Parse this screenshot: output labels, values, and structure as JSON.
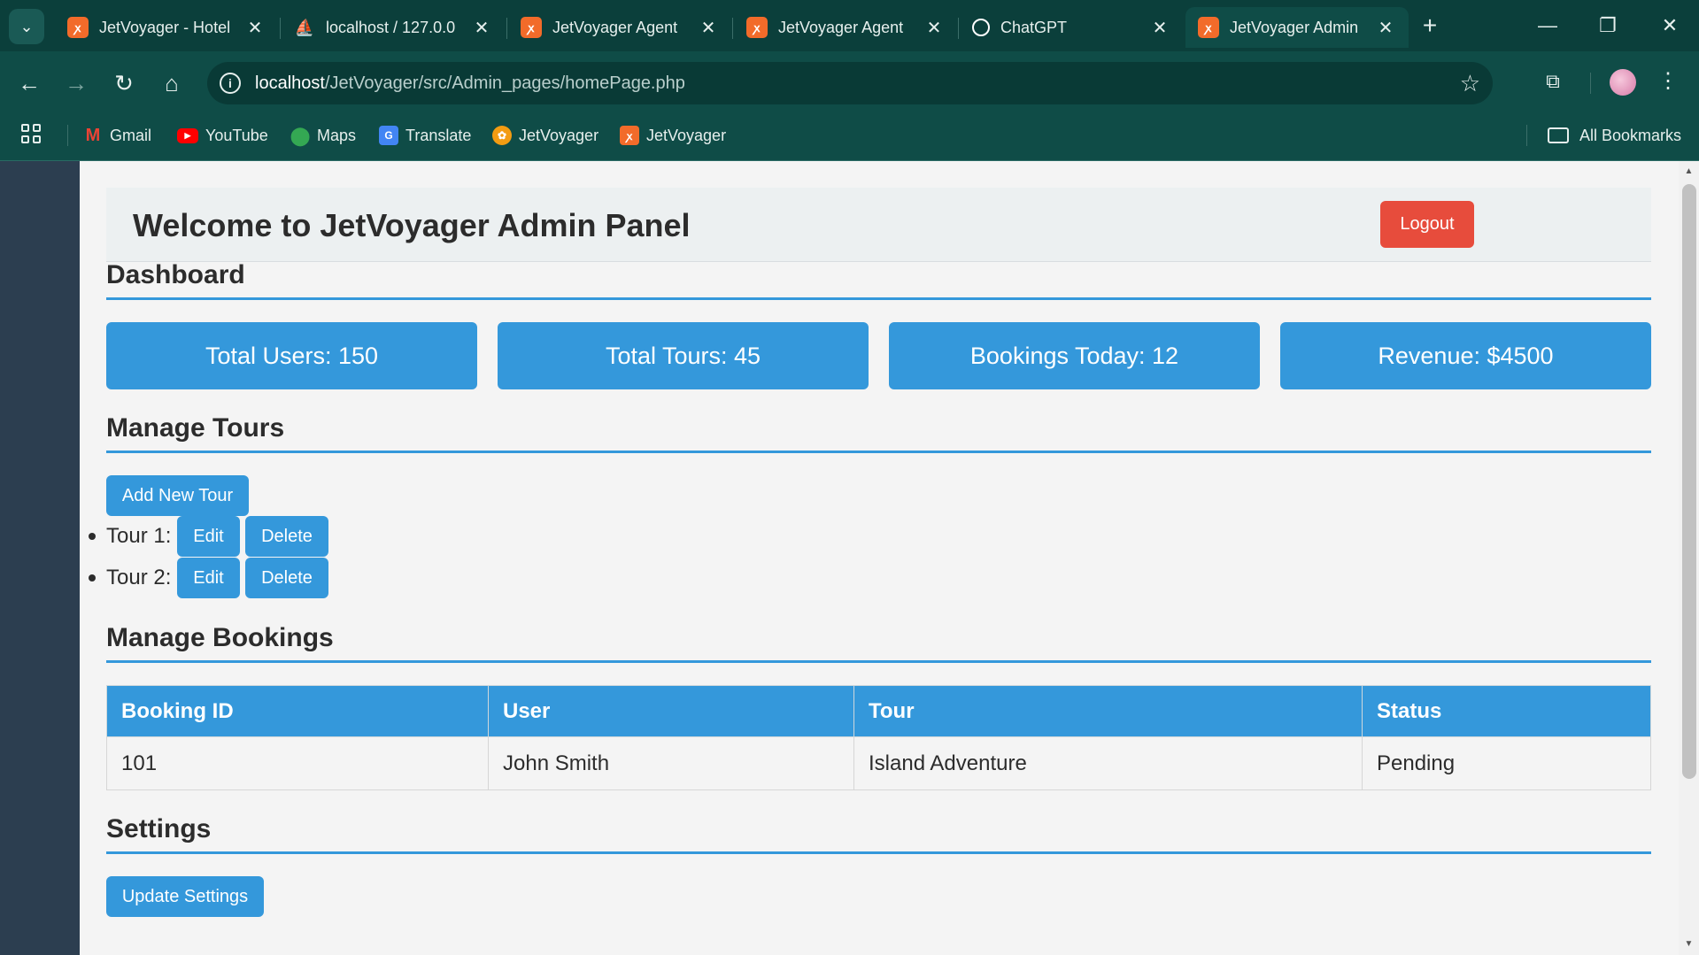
{
  "browser": {
    "tabs": [
      {
        "title": "JetVoyager - Hotel",
        "favicon": "xampp-icon"
      },
      {
        "title": "localhost / 127.0.0",
        "favicon": "phpmyadmin-icon"
      },
      {
        "title": "JetVoyager Agent",
        "favicon": "xampp-icon"
      },
      {
        "title": "JetVoyager Agent",
        "favicon": "xampp-icon"
      },
      {
        "title": "ChatGPT",
        "favicon": "chatgpt-icon"
      },
      {
        "title": "JetVoyager Admin",
        "favicon": "xampp-icon",
        "active": true
      }
    ],
    "url_host": "localhost",
    "url_path": "/JetVoyager/src/Admin_pages/homePage.php",
    "bookmarks": [
      "Gmail",
      "YouTube",
      "Maps",
      "Translate",
      "JetVoyager",
      "JetVoyager"
    ],
    "all_bookmarks": "All Bookmarks"
  },
  "page": {
    "header_title": "Welcome to JetVoyager Admin Panel",
    "logout_label": "Logout",
    "dashboard": {
      "title": "Dashboard",
      "stats": [
        "Total Users: 150",
        "Total Tours: 45",
        "Bookings Today: 12",
        "Revenue: $4500"
      ]
    },
    "manage_tours": {
      "title": "Manage Tours",
      "add_label": "Add New Tour",
      "tours": [
        {
          "label": "Tour 1:",
          "edit": "Edit",
          "delete": "Delete"
        },
        {
          "label": "Tour 2:",
          "edit": "Edit",
          "delete": "Delete"
        }
      ]
    },
    "manage_bookings": {
      "title": "Manage Bookings",
      "columns": [
        "Booking ID",
        "User",
        "Tour",
        "Status"
      ],
      "rows": [
        [
          "101",
          "John Smith",
          "Island Adventure",
          "Pending"
        ]
      ]
    },
    "settings": {
      "title": "Settings",
      "update_label": "Update Settings"
    }
  },
  "colors": {
    "accent": "#3498db",
    "danger": "#e74c3c",
    "sidebar": "#2c3e50",
    "chrome": "#0f4c47"
  }
}
